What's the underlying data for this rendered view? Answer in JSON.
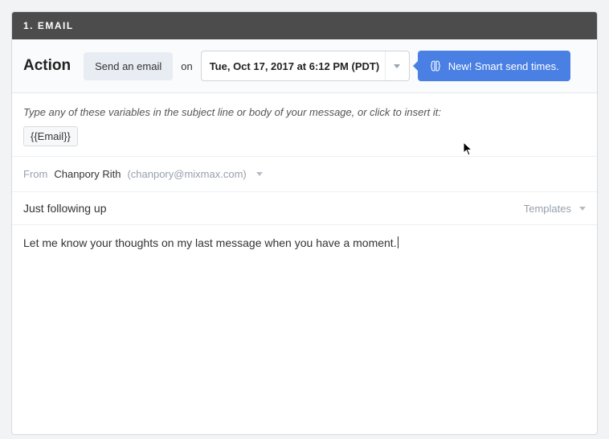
{
  "header": {
    "title": "1.  EMAIL"
  },
  "action": {
    "label": "Action",
    "send_label": "Send an email",
    "on_label": "on",
    "date_value": "Tue, Oct 17, 2017 at 6:12 PM (PDT)",
    "smart_send_label": "New! Smart send times."
  },
  "variables": {
    "hint": "Type any of these variables in the subject line or body of your message, or click to insert it:",
    "chips": [
      "{{Email}}"
    ]
  },
  "from": {
    "label": "From",
    "name": "Chanpory Rith",
    "email": "(chanpory@mixmax.com)"
  },
  "subject": {
    "value": "Just following up",
    "templates_label": "Templates"
  },
  "body": {
    "text": "Let me know your thoughts on my last message when you have a moment."
  }
}
